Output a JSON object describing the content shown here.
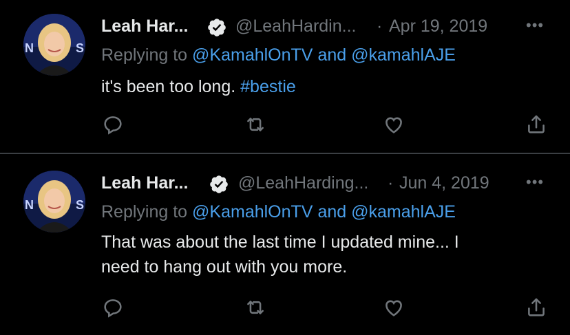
{
  "tweets": [
    {
      "name": "Leah Har...",
      "handle": "@LeahHardin...",
      "separator": "·",
      "date": "Apr 19, 2019",
      "more": "•••",
      "replying_prefix": "Replying to",
      "reply_user1": "@KamahlOnTV",
      "reply_and": "and",
      "reply_user2": "@kamahlAJE",
      "text": "it's been too long.",
      "hashtag": "#bestie"
    },
    {
      "name": "Leah Har...",
      "handle": "@LeahHarding...",
      "separator": "·",
      "date": "Jun 4, 2019",
      "more": "•••",
      "replying_prefix": "Replying to",
      "reply_user1": "@KamahlOnTV",
      "reply_and": "and",
      "reply_user2": "@kamahlAJE",
      "text_line1": "That was about the last time I updated mine... I",
      "text_line2": "need to hang out with you more."
    }
  ],
  "icons": {
    "reply": "reply-icon",
    "retweet": "retweet-icon",
    "like": "like-icon",
    "share": "share-icon",
    "verified": "verified-badge-icon"
  },
  "colors": {
    "background": "#000000",
    "primary_text": "#e7e9ea",
    "secondary_text": "#71767b",
    "link": "#4a9fea",
    "divider": "#3b3f43"
  }
}
